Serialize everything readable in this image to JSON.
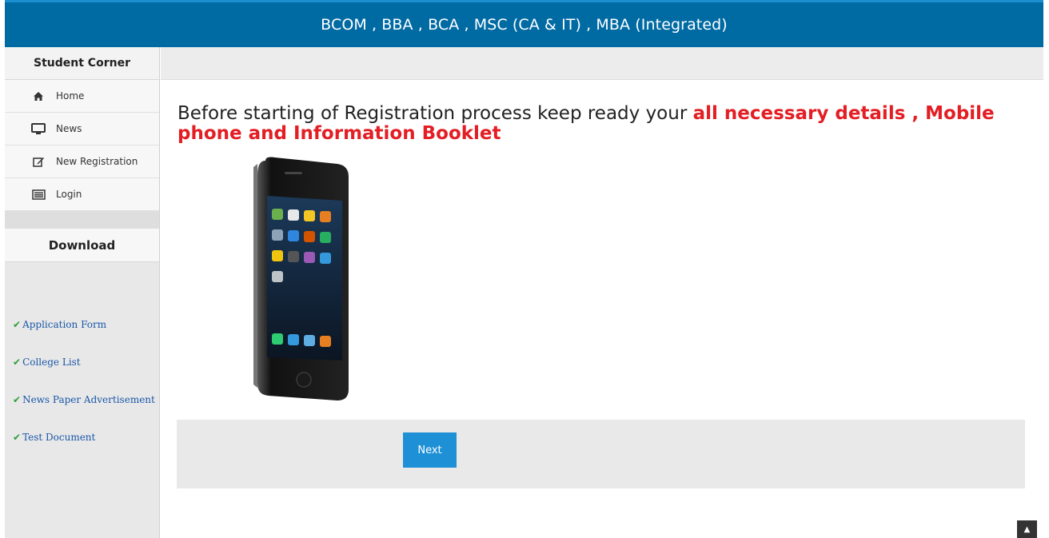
{
  "header": {
    "title": "BCOM , BBA , BCA , MSC (CA & IT) , MBA (Integrated)"
  },
  "sidebar": {
    "heading": "Student Corner",
    "items": [
      {
        "label": "Home",
        "icon": "home-icon"
      },
      {
        "label": "News",
        "icon": "monitor-icon"
      },
      {
        "label": "New Registration",
        "icon": "edit-icon"
      },
      {
        "label": "Login",
        "icon": "list-icon"
      }
    ],
    "download_heading": "Download",
    "downloads": [
      {
        "label": "Application Form"
      },
      {
        "label": "College List"
      },
      {
        "label": "News Paper Advertisement"
      },
      {
        "label": "Test Document"
      }
    ]
  },
  "main": {
    "message_prefix": "Before starting  of Registration process keep ready your ",
    "message_highlight": "all necessary details , Mobile phone and Information Booklet",
    "next_label": "Next"
  },
  "colors": {
    "header_bg": "#006aa3",
    "highlight": "#e31e24",
    "button": "#1e90d6",
    "check": "#2e9e3a"
  }
}
